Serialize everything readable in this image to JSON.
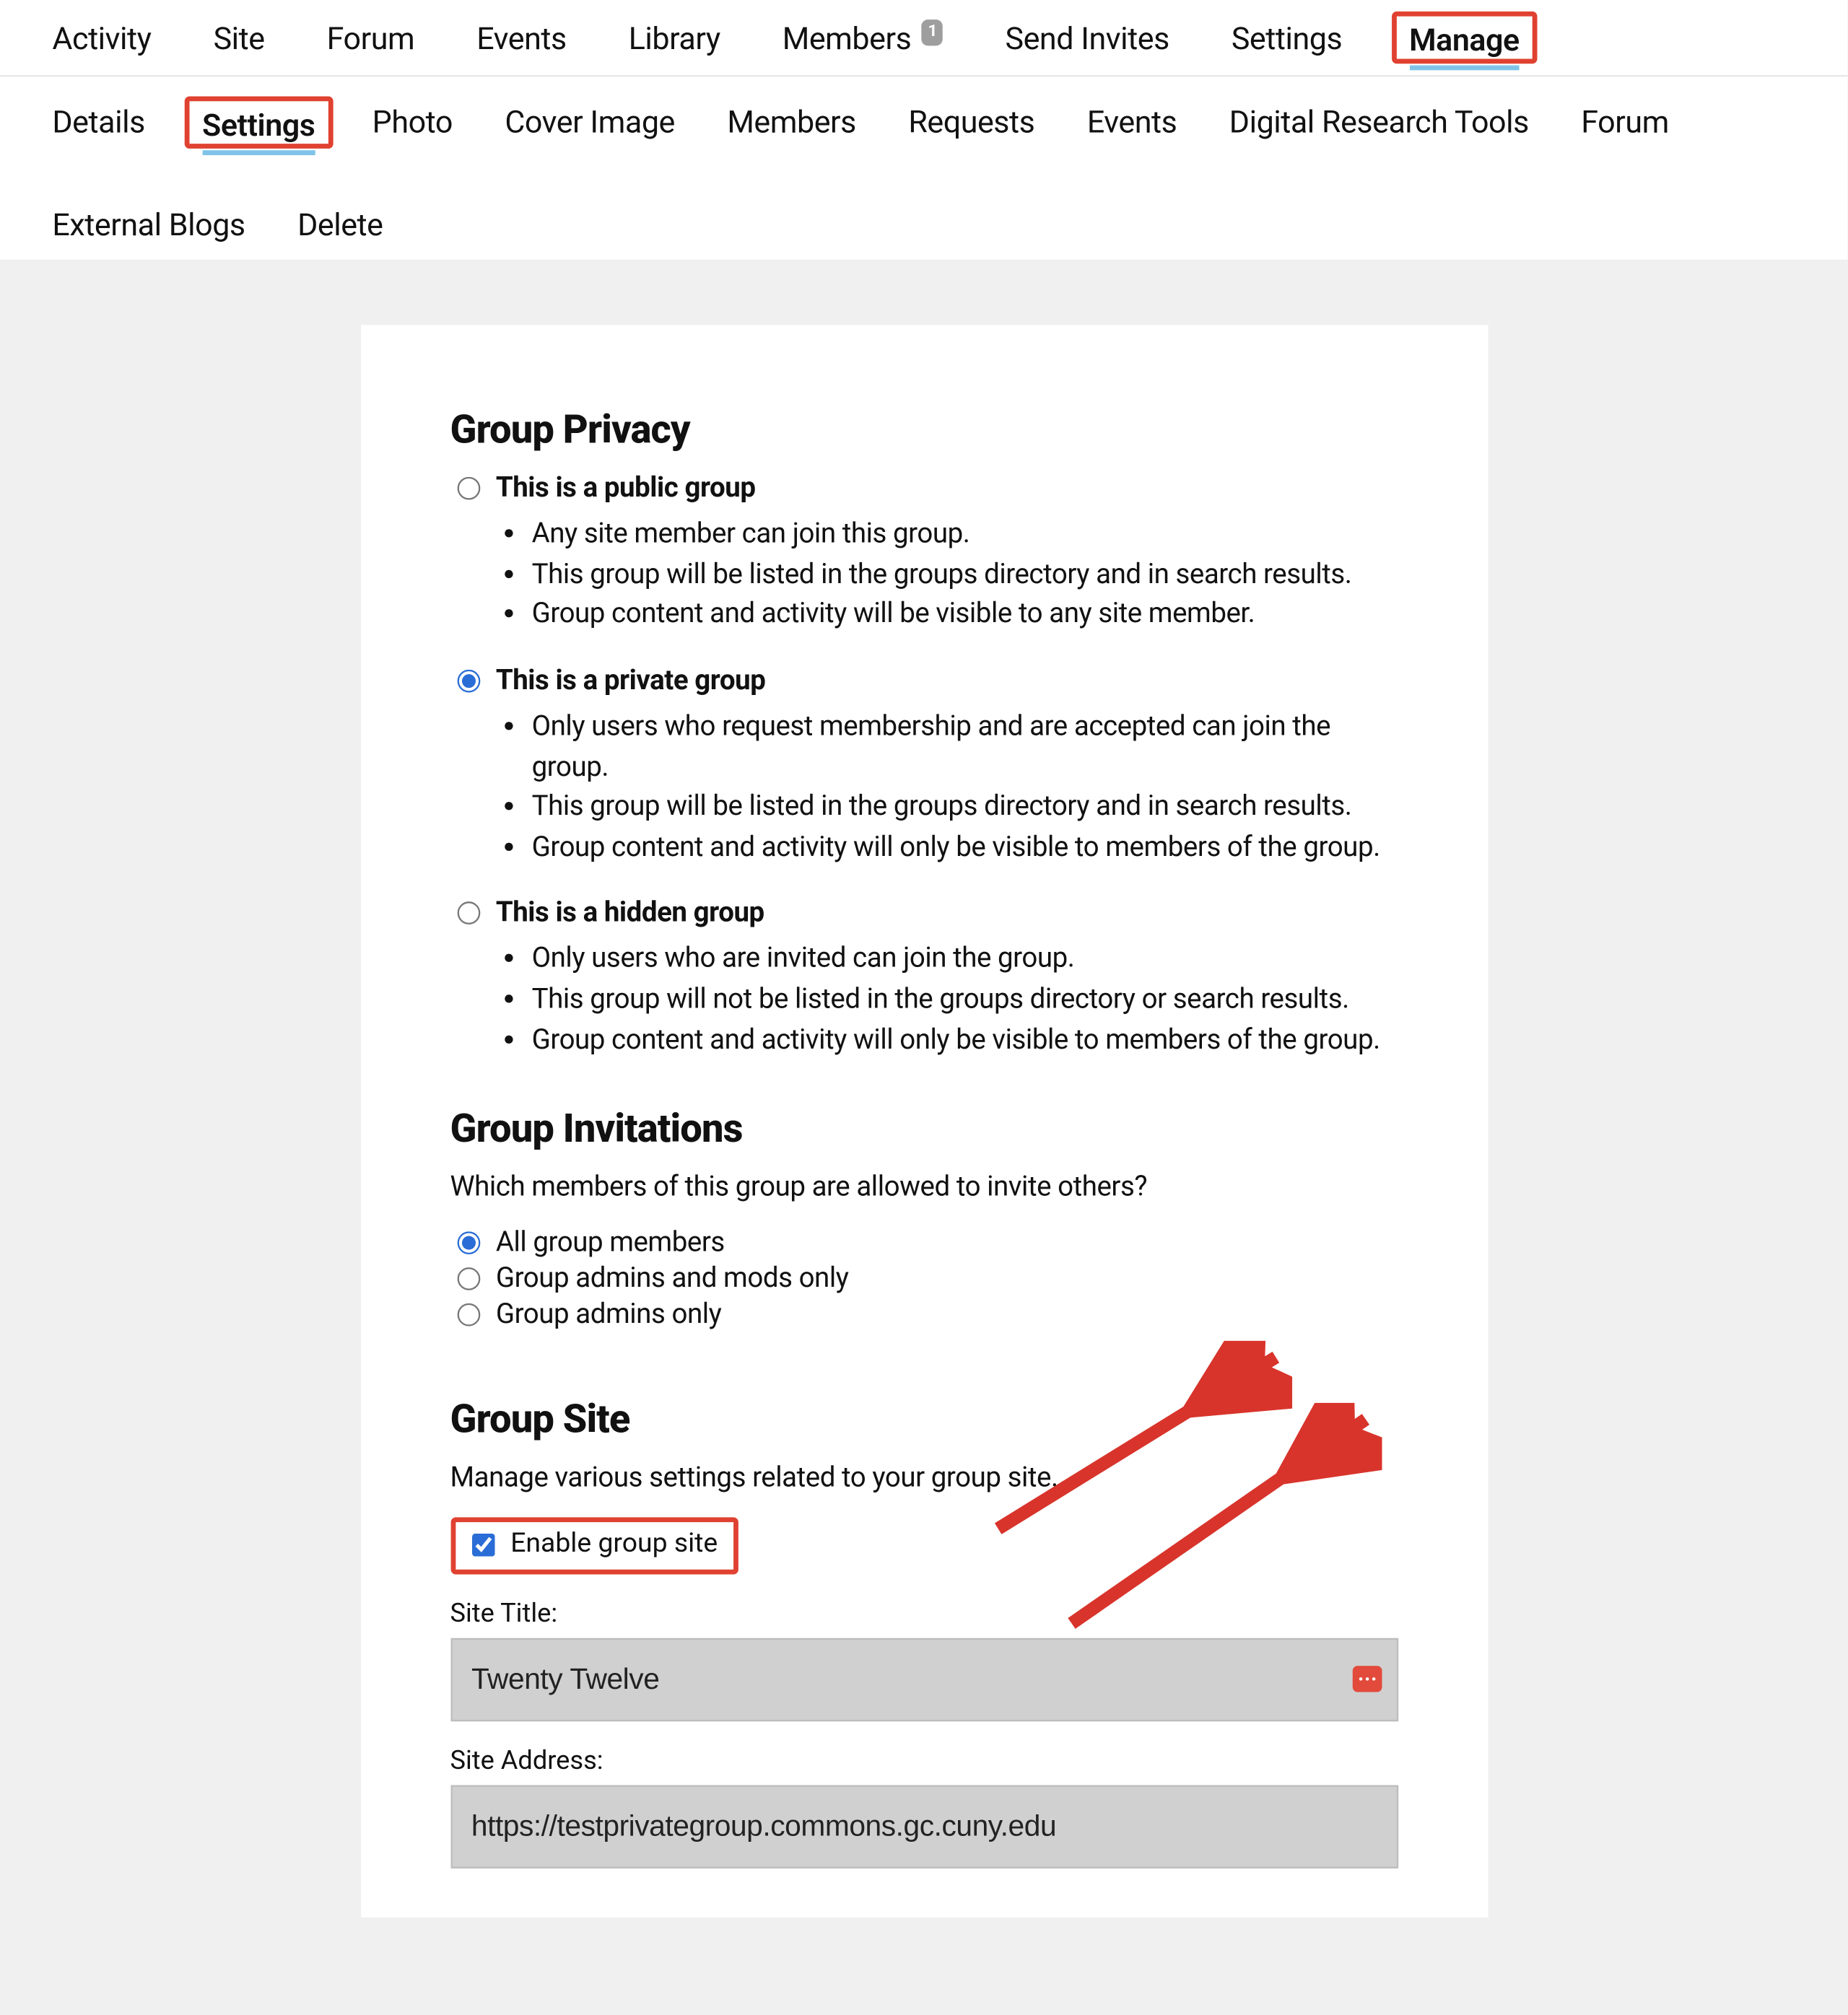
{
  "nav_primary": {
    "items": [
      {
        "label": "Activity"
      },
      {
        "label": "Site"
      },
      {
        "label": "Forum"
      },
      {
        "label": "Events"
      },
      {
        "label": "Library"
      },
      {
        "label": "Members",
        "badge": "1"
      },
      {
        "label": "Send Invites"
      },
      {
        "label": "Settings"
      },
      {
        "label": "Manage",
        "active": true,
        "highlighted": true
      }
    ]
  },
  "nav_secondary": {
    "items": [
      {
        "label": "Details"
      },
      {
        "label": "Settings",
        "active": true,
        "highlighted": true
      },
      {
        "label": "Photo"
      },
      {
        "label": "Cover Image"
      },
      {
        "label": "Members"
      },
      {
        "label": "Requests"
      },
      {
        "label": "Events"
      },
      {
        "label": "Digital Research Tools"
      },
      {
        "label": "Forum"
      },
      {
        "label": "External Blogs"
      },
      {
        "label": "Delete"
      }
    ]
  },
  "privacy": {
    "heading": "Group Privacy",
    "options": [
      {
        "label": "This is a public group",
        "selected": false,
        "points": [
          "Any site member can join this group.",
          "This group will be listed in the groups directory and in search results.",
          "Group content and activity will be visible to any site member."
        ]
      },
      {
        "label": "This is a private group",
        "selected": true,
        "points": [
          "Only users who request membership and are accepted can join the group.",
          "This group will be listed in the groups directory and in search results.",
          "Group content and activity will only be visible to members of the group."
        ]
      },
      {
        "label": "This is a hidden group",
        "selected": false,
        "points": [
          "Only users who are invited can join the group.",
          "This group will not be listed in the groups directory or search results.",
          "Group content and activity will only be visible to members of the group."
        ]
      }
    ]
  },
  "invitations": {
    "heading": "Group Invitations",
    "prompt": "Which members of this group are allowed to invite others?",
    "options": [
      {
        "label": "All group members",
        "selected": true
      },
      {
        "label": "Group admins and mods only",
        "selected": false
      },
      {
        "label": "Group admins only",
        "selected": false
      }
    ]
  },
  "site": {
    "heading": "Group Site",
    "desc": "Manage various settings related to your group site.",
    "enable_label": "Enable group site",
    "enable_checked": true,
    "title_label": "Site Title:",
    "title_value": "Twenty Twelve",
    "address_label": "Site Address:",
    "address_value": "https://testprivategroup.commons.gc.cuny.edu"
  }
}
